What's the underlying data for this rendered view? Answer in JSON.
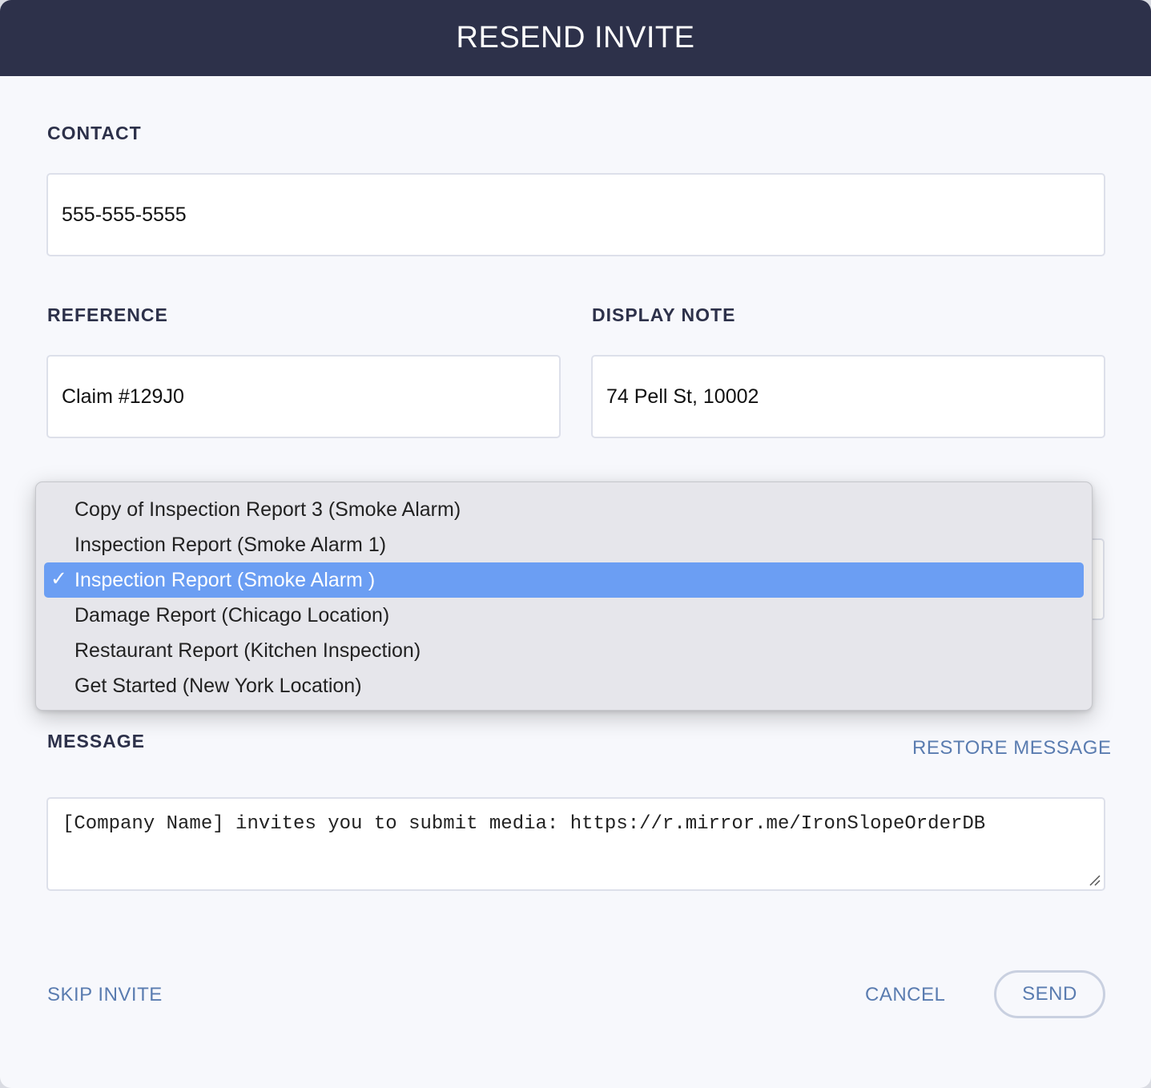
{
  "dialog": {
    "title": "RESEND INVITE"
  },
  "contact": {
    "label": "CONTACT",
    "value": "555-555-5555"
  },
  "reference": {
    "label": "REFERENCE",
    "value": "Claim #129J0"
  },
  "display_note": {
    "label": "DISPLAY NOTE",
    "value": "74 Pell St, 10002"
  },
  "template_dropdown": {
    "options": [
      "Copy of Inspection Report 3 (Smoke Alarm)",
      "Inspection Report (Smoke Alarm 1)",
      "Inspection Report (Smoke Alarm )",
      "Damage Report (Chicago Location)",
      "Restaurant Report (Kitchen Inspection)",
      "Get Started (New York Location)"
    ],
    "selected_index": 2,
    "check_glyph": "✓"
  },
  "message": {
    "label": "MESSAGE",
    "restore_label": "RESTORE MESSAGE",
    "value": "[Company Name] invites you to submit media: https://r.mirror.me/IronSlopeOrderDB"
  },
  "footer": {
    "skip_label": "SKIP INVITE",
    "cancel_label": "CANCEL",
    "send_label": "SEND"
  },
  "colors": {
    "header_bg": "#2d314a",
    "accent_link": "#5a7cb0",
    "selection": "#6b9ef3"
  }
}
